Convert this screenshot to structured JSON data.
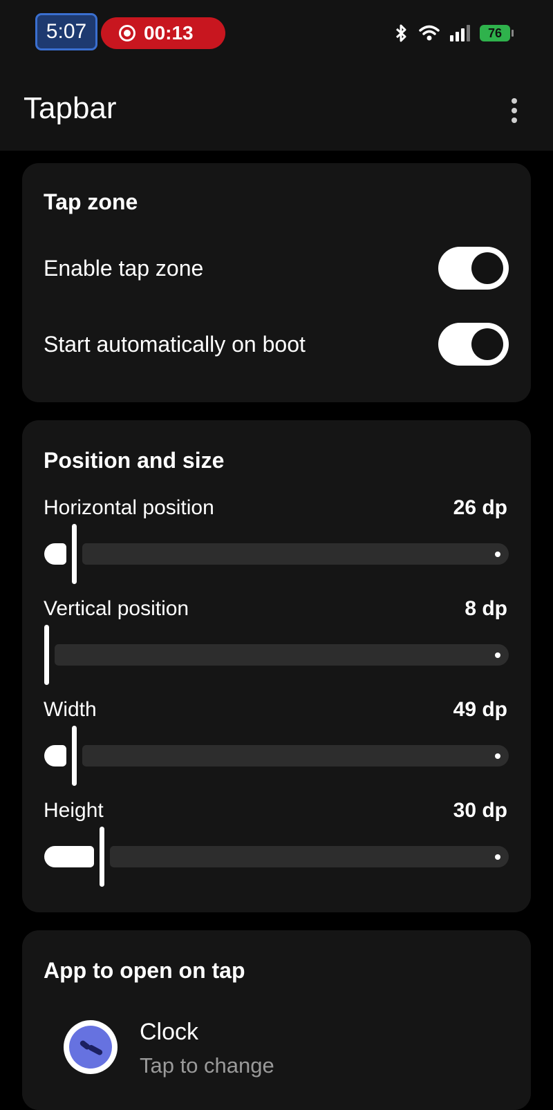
{
  "status_bar": {
    "time": "5:07",
    "recording_timer": "00:13",
    "battery_level": "76",
    "icons": [
      "bluetooth-icon",
      "wifi-icon",
      "signal-icon",
      "battery-icon"
    ],
    "colors": {
      "recording": "#c8161f",
      "battery": "#2fb24c",
      "clock_chip": "#1e3a70"
    }
  },
  "app_bar": {
    "title": "Tapbar",
    "menu_icon": "more-vert-icon"
  },
  "tap_zone": {
    "title": "Tap zone",
    "enable_label": "Enable tap zone",
    "enable_on": true,
    "boot_label": "Start automatically on boot",
    "boot_on": true
  },
  "position_size": {
    "title": "Position and size",
    "sliders": [
      {
        "label": "Horizontal position",
        "value_text": "26 dp",
        "fraction": 0.06
      },
      {
        "label": "Vertical position",
        "value_text": "8 dp",
        "fraction": 0.0
      },
      {
        "label": "Width",
        "value_text": "49 dp",
        "fraction": 0.06
      },
      {
        "label": "Height",
        "value_text": "30 dp",
        "fraction": 0.12
      }
    ]
  },
  "app_to_open": {
    "title": "App to open on tap",
    "app_name": "Clock",
    "subtitle": "Tap to change",
    "icon": "clock-app-icon"
  }
}
